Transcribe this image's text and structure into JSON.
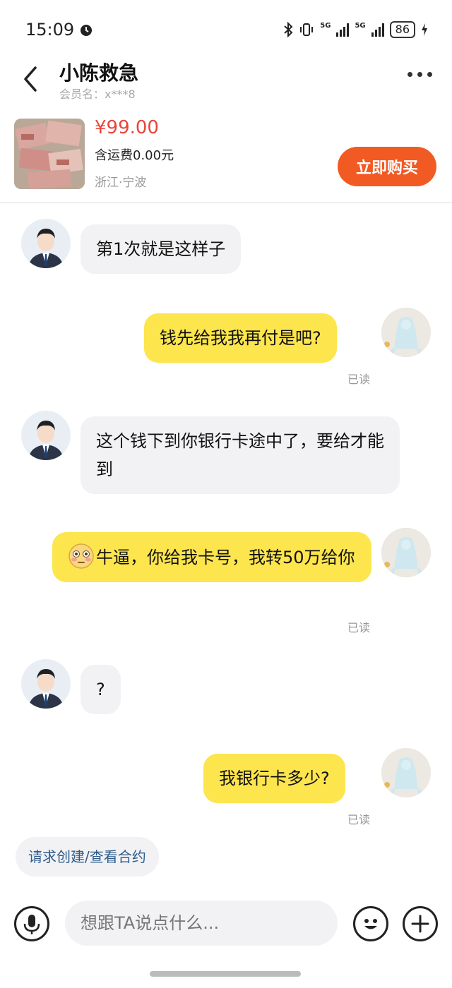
{
  "status": {
    "time": "15:09",
    "battery": "86",
    "network1": "5G",
    "network2": "5G"
  },
  "header": {
    "title": "小陈救急",
    "member": "会员名：x***8"
  },
  "product": {
    "price": "¥99.00",
    "shipping": "含运费0.00元",
    "location": "浙江·宁波",
    "buy_label": "立即购买"
  },
  "messages": [
    {
      "from": "them",
      "text": "第1次就是这样子"
    },
    {
      "from": "me",
      "text": "钱先给我我再付是吧?",
      "status": "已读"
    },
    {
      "from": "them",
      "text": "这个钱下到你银行卡途中了，要给才能到"
    },
    {
      "from": "me",
      "text": "牛逼，你给我卡号，我转50万给你",
      "emoji": "flushed-face",
      "status": "已读"
    },
    {
      "from": "them",
      "text": "?"
    },
    {
      "from": "me",
      "text": "我银行卡多少?",
      "status": "已读"
    }
  ],
  "contract_label": "请求创建/查看合约",
  "input": {
    "placeholder": "想跟TA说点什么..."
  },
  "icons": {
    "back": "back-arrow-icon",
    "more": "more-icon",
    "mic": "microphone-icon",
    "emoji": "emoji-icon",
    "add": "plus-icon"
  },
  "colors": {
    "accent": "#f25a24",
    "price": "#e8453c",
    "outgoing_bubble": "#fde54d",
    "incoming_bubble": "#f2f2f4"
  }
}
